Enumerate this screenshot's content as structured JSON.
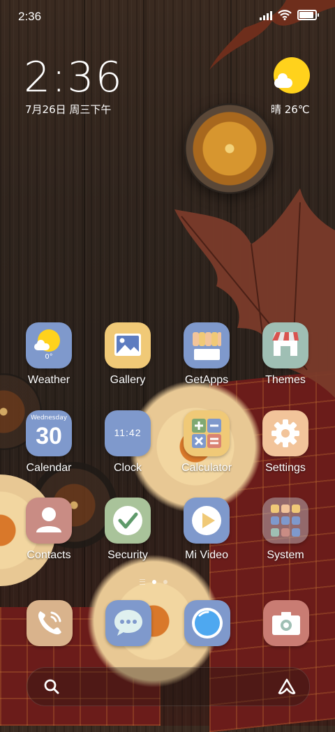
{
  "status_bar": {
    "time": "2:36",
    "battery_level": 0.85
  },
  "clock_widget": {
    "time": "2:36",
    "date": "7月26日 周三下午"
  },
  "weather_widget": {
    "text": "晴 26℃"
  },
  "apps": [
    {
      "label": "Weather",
      "icon": "weather-icon",
      "badge": "0°"
    },
    {
      "label": "Gallery",
      "icon": "gallery-icon"
    },
    {
      "label": "GetApps",
      "icon": "getapps-icon"
    },
    {
      "label": "Themes",
      "icon": "themes-icon"
    },
    {
      "label": "Calendar",
      "icon": "calendar-icon",
      "weekday": "Wednesday",
      "day": "30"
    },
    {
      "label": "Clock",
      "icon": "clock-icon",
      "time": "11:42"
    },
    {
      "label": "Calculator",
      "icon": "calculator-icon"
    },
    {
      "label": "Settings",
      "icon": "gear-icon"
    },
    {
      "label": "Contacts",
      "icon": "contacts-icon"
    },
    {
      "label": "Security",
      "icon": "security-check-icon"
    },
    {
      "label": "Mi Video",
      "icon": "play-icon"
    },
    {
      "label": "System",
      "icon": "folder-icon"
    }
  ],
  "page_indicator": {
    "pages": 2,
    "active": 1
  },
  "dock": [
    {
      "icon": "phone-icon",
      "color": "#d9b38c"
    },
    {
      "icon": "messages-icon",
      "color": "#7f99cc"
    },
    {
      "icon": "browser-icon",
      "color": "#7f99cc"
    },
    {
      "icon": "camera-icon",
      "color": "#c97c73"
    }
  ],
  "search_bar": {
    "left_icon": "search-icon",
    "right_icon": "app-vault-icon"
  },
  "colors": {
    "blue_tile": "#7f99cc",
    "yellow_tile": "#f0c977",
    "teal_tile": "#9fbfb4",
    "peach_tile": "#f2c49a",
    "green_tile": "#a9c39a",
    "rose_tile": "#c98c84",
    "sun": "#ffd21c"
  }
}
